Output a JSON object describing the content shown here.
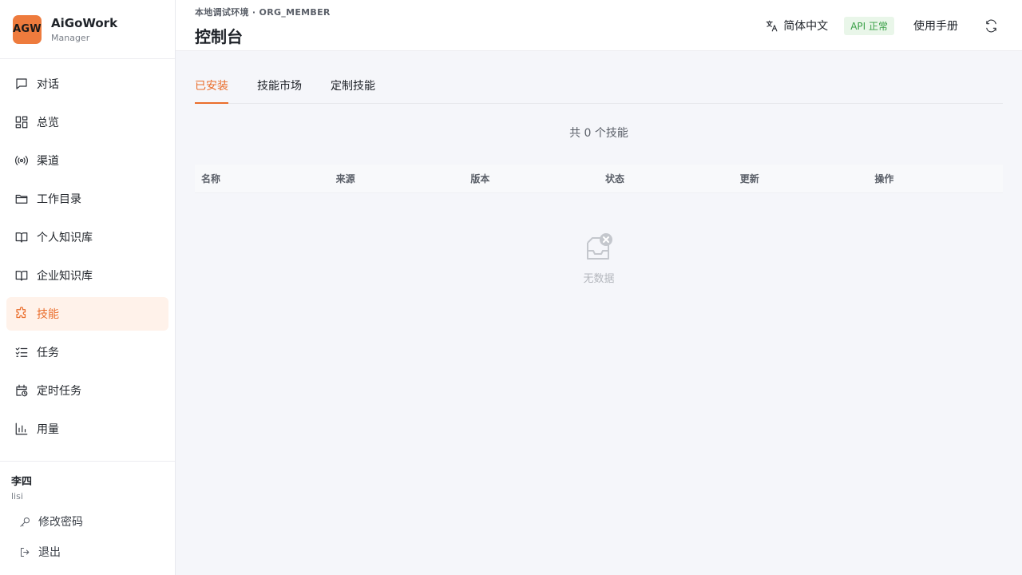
{
  "brand": {
    "logo_text": "AGW",
    "name": "AiGoWork",
    "role": "Manager"
  },
  "sidebar": {
    "items": [
      {
        "label": "对话",
        "icon": "chat-icon"
      },
      {
        "label": "总览",
        "icon": "dashboard-icon"
      },
      {
        "label": "渠道",
        "icon": "broadcast-icon"
      },
      {
        "label": "工作目录",
        "icon": "folder-icon"
      },
      {
        "label": "个人知识库",
        "icon": "book-icon"
      },
      {
        "label": "企业知识库",
        "icon": "book-icon"
      },
      {
        "label": "技能",
        "icon": "puzzle-icon",
        "active": true
      },
      {
        "label": "任务",
        "icon": "checklist-icon"
      },
      {
        "label": "定时任务",
        "icon": "calendar-clock-icon"
      },
      {
        "label": "用量",
        "icon": "bar-chart-icon"
      }
    ]
  },
  "user": {
    "name": "李四",
    "id": "lisi",
    "change_password": "修改密码",
    "logout": "退出"
  },
  "header": {
    "env": "本地调试环境 · ORG_MEMBER",
    "title": "控制台",
    "language": "简体中文",
    "api_status": "API 正常",
    "manual": "使用手册"
  },
  "tabs": [
    "已安装",
    "技能市场",
    "定制技能"
  ],
  "count_text": "共 0 个技能",
  "table": {
    "columns": [
      "名称",
      "来源",
      "版本",
      "状态",
      "更新",
      "操作"
    ]
  },
  "empty_text": "无数据",
  "colors": {
    "accent": "#ea6d2b",
    "api_ok": "#3aa047"
  }
}
